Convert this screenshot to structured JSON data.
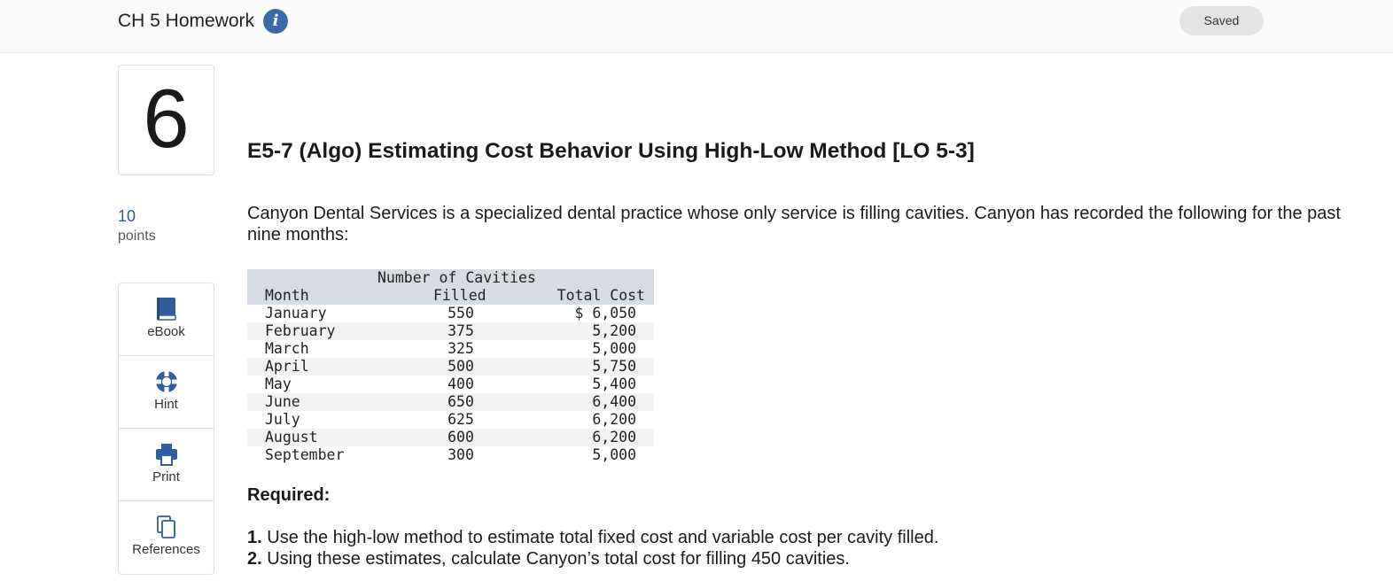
{
  "header": {
    "assignment_title": "CH 5 Homework",
    "info_glyph": "i",
    "saved_label": "Saved"
  },
  "question": {
    "number": "6",
    "points_value": "10",
    "points_label": "points",
    "title": "E5-7 (Algo) Estimating Cost Behavior Using High-Low Method [LO 5-3]",
    "intro": "Canyon Dental Services is a specialized dental practice whose only service is filling cavities. Canyon has recorded the following for the past nine months:"
  },
  "tools": [
    {
      "label": "eBook",
      "icon": "book-icon"
    },
    {
      "label": "Hint",
      "icon": "lifebuoy-icon"
    },
    {
      "label": "Print",
      "icon": "printer-icon"
    },
    {
      "label": "References",
      "icon": "copy-pages-icon"
    }
  ],
  "table": {
    "header_line1": "Number of Cavities",
    "col_month": "Month",
    "col_cavities": "Filled",
    "col_cost": "Total Cost",
    "rows": [
      {
        "month": "January",
        "cavities": "550",
        "cost": "$ 6,050"
      },
      {
        "month": "February",
        "cavities": "375",
        "cost": "5,200"
      },
      {
        "month": "March",
        "cavities": "325",
        "cost": "5,000"
      },
      {
        "month": "April",
        "cavities": "500",
        "cost": "5,750"
      },
      {
        "month": "May",
        "cavities": "400",
        "cost": "5,400"
      },
      {
        "month": "June",
        "cavities": "650",
        "cost": "6,400"
      },
      {
        "month": "July",
        "cavities": "625",
        "cost": "6,200"
      },
      {
        "month": "August",
        "cavities": "600",
        "cost": "6,200"
      },
      {
        "month": "September",
        "cavities": "300",
        "cost": "5,000"
      }
    ]
  },
  "required": {
    "heading": "Required:",
    "items": [
      {
        "num": "1.",
        "text": "Use the high-low method to estimate total fixed cost and variable cost per cavity filled."
      },
      {
        "num": "2.",
        "text": "Using these estimates, calculate Canyon’s total cost for filling 450 cavities."
      }
    ]
  },
  "colors": {
    "accent": "#3c6aa9",
    "points": "#2c5a96",
    "table_header": "#d6dbe6"
  }
}
